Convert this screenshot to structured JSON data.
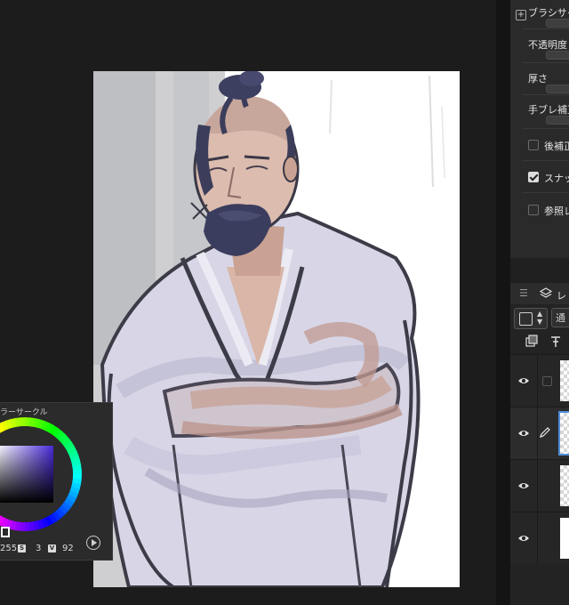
{
  "tool_property": {
    "brush_size_label": "ブラシサイ",
    "opacity_label": "不透明度",
    "thickness_label": "厚さ",
    "stabilization_label": "手ブレ補正",
    "post_correction_label": "後補正",
    "post_correction_checked": false,
    "snap_label": "スナップ",
    "snap_checked": true,
    "reference_label": "参照レ",
    "reference_checked": false
  },
  "layer_panel": {
    "menu_icon": "list-icon",
    "tab_icon": "layers-icon",
    "tab_label": "レ",
    "blend_next_label": "通",
    "layers": [
      {
        "visible": true,
        "editing": false,
        "thumb": "checker"
      },
      {
        "visible": true,
        "editing": true,
        "thumb": "checker"
      },
      {
        "visible": true,
        "editing": false,
        "thumb": "checker"
      },
      {
        "visible": true,
        "editing": false,
        "thumb": "white"
      }
    ]
  },
  "color_palette": {
    "title": "ラーサークル",
    "h_value": "255",
    "h_badge": "S",
    "s_value": "3",
    "s_badge": "V",
    "v_value": "92",
    "current_hue_color": "#4a2ad8"
  },
  "colors": {
    "background": "#1c1c1c",
    "panel": "#2a2a2a",
    "accent": "#4f8ed8"
  }
}
